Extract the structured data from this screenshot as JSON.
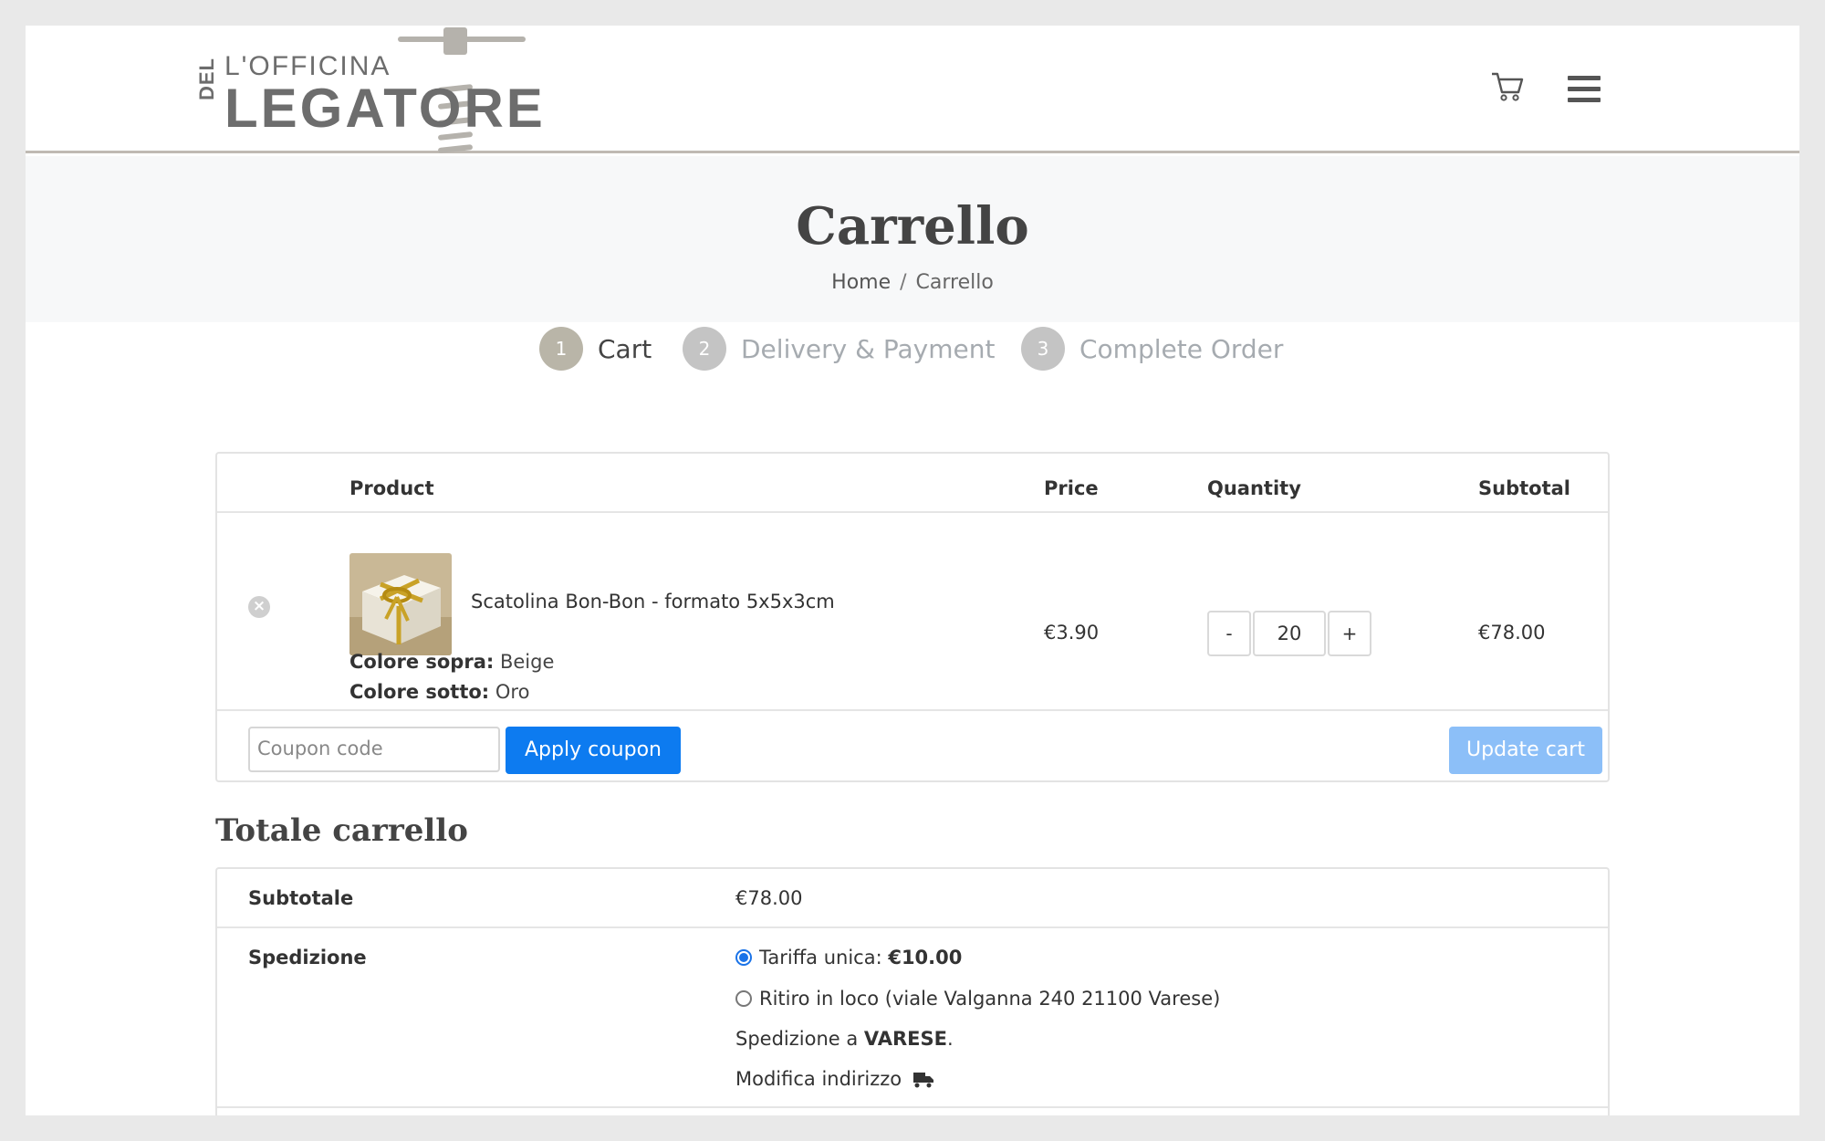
{
  "header": {
    "logo_line1": "L'OFFICINA",
    "logo_vertical": "DEL",
    "logo_line2": "LEGATORE",
    "cart_icon": "cart-icon",
    "menu_icon": "hamburger-menu-icon"
  },
  "title_band": {
    "title": "Carrello",
    "breadcrumb": [
      {
        "label": "Home"
      },
      {
        "label": "Carrello"
      }
    ],
    "breadcrumb_sep": "/"
  },
  "steps": [
    {
      "num": "1",
      "label": "Cart",
      "active": true
    },
    {
      "num": "2",
      "label": "Delivery & Payment",
      "active": false
    },
    {
      "num": "3",
      "label": "Complete Order",
      "active": false
    }
  ],
  "cart_table": {
    "headers": {
      "product": "Product",
      "price": "Price",
      "quantity": "Quantity",
      "subtotal": "Subtotal"
    },
    "items": [
      {
        "name": "Scatolina Bon-Bon - formato 5x5x3cm",
        "attrs": [
          {
            "key": "Colore sopra:",
            "value": "Beige"
          },
          {
            "key": "Colore sotto:",
            "value": "Oro"
          }
        ],
        "price": "€3.90",
        "quantity": "20",
        "subtotal": "€78.00"
      }
    ],
    "qty_minus": "-",
    "qty_plus": "+",
    "coupon_placeholder": "Coupon code",
    "apply_coupon": "Apply coupon",
    "update_cart": "Update cart"
  },
  "totals": {
    "title": "Totale carrello",
    "subtotal_label": "Subtotale",
    "subtotal_value": "€78.00",
    "shipping_label": "Spedizione",
    "shipping_options": [
      {
        "label": "Tariffa unica: ",
        "amount": "€10.00",
        "selected": true
      },
      {
        "label": "Ritiro in loco (viale Valganna 240 21100 Varese)",
        "amount": "",
        "selected": false
      }
    ],
    "shipping_to_prefix": "Spedizione a ",
    "shipping_to_city": "VARESE",
    "shipping_to_suffix": ".",
    "change_address": "Modifica indirizzo"
  },
  "colors": {
    "step_active": "#b9b5a8",
    "step_inactive": "#c4c4c4",
    "primary_button": "#0d7bf0",
    "disabled_button": "#8cbff8"
  }
}
